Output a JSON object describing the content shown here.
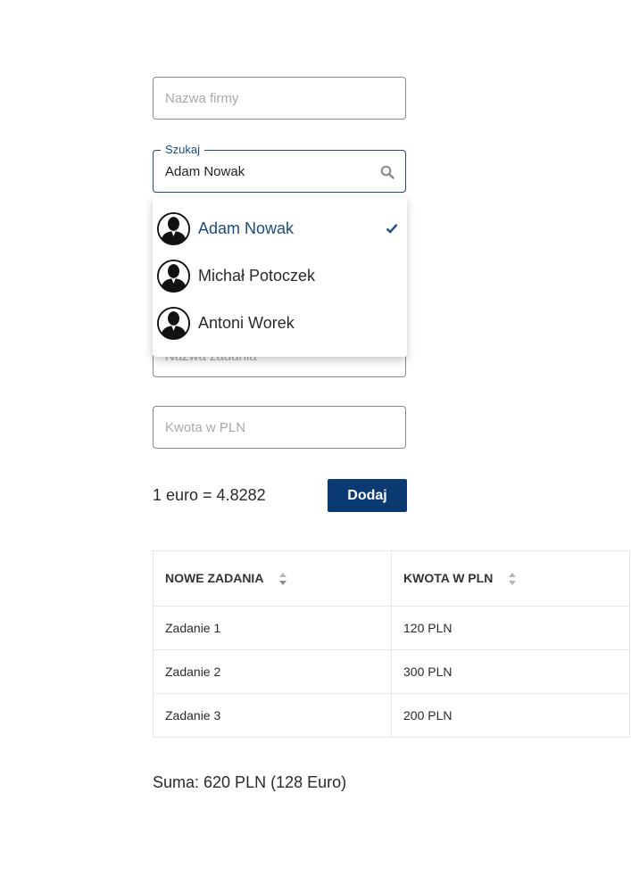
{
  "form": {
    "company_placeholder": "Nazwa firmy",
    "search_label": "Szukaj",
    "search_value": "Adam Nowak",
    "task_placeholder": "Nazwa zadania",
    "amount_placeholder": "Kwota w PLN"
  },
  "dropdown": {
    "items": [
      {
        "name": "Adam Nowak",
        "selected": true,
        "icon": "avatar-icon"
      },
      {
        "name": "Michał Potoczek",
        "selected": false,
        "icon": "avatar-icon"
      },
      {
        "name": "Antoni Worek",
        "selected": false,
        "icon": "avatar-icon"
      }
    ],
    "selected_icon": "check-icon"
  },
  "rate_text": "1 euro = 4.8282",
  "add_button": "Dodaj",
  "table": {
    "headers": [
      "NOWE ZADANIA",
      "KWOTA W PLN"
    ],
    "rows": [
      [
        "Zadanie 1",
        "120 PLN"
      ],
      [
        "Zadanie 2",
        "300 PLN"
      ],
      [
        "Zadanie 3",
        "200 PLN"
      ]
    ]
  },
  "sum_text": "Suma: 620 PLN (128 Euro)",
  "colors": {
    "accent": "#1d4b80",
    "button_bg": "#0b3a72",
    "border": "#8a8a8a"
  }
}
